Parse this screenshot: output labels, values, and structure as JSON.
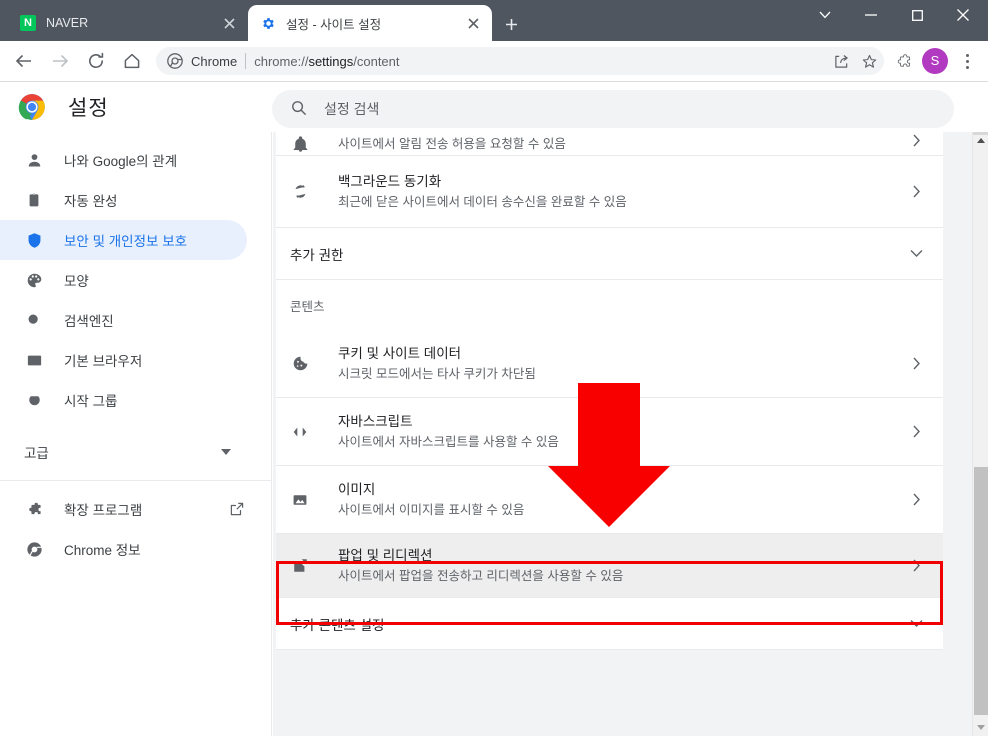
{
  "window": {
    "controls": {
      "chevron_label": "tab-search-chevron",
      "minimize_label": "minimize",
      "maximize_label": "maximize",
      "close_label": "close"
    }
  },
  "tabs": [
    {
      "title": "NAVER",
      "favicon": "N",
      "active": false
    },
    {
      "title": "설정 - 사이트 설정",
      "favicon": "gear",
      "active": true
    }
  ],
  "newtab": {
    "label": "+"
  },
  "omnibox": {
    "scheme_label": "Chrome",
    "url_prefix": "chrome://",
    "url_bold": "settings",
    "url_suffix": "/content",
    "full_url": "chrome://settings/content"
  },
  "settings": {
    "title": "설정",
    "search": {
      "placeholder": "설정 검색",
      "value": ""
    }
  },
  "sidebar": {
    "items": [
      {
        "label": "나와 Google의 관계",
        "icon": "person-icon",
        "active": false
      },
      {
        "label": "자동 완성",
        "icon": "clipboard-icon",
        "active": false
      },
      {
        "label": "보안 및 개인정보 보호",
        "icon": "shield-icon",
        "active": true
      },
      {
        "label": "모양",
        "icon": "palette-icon",
        "active": false
      },
      {
        "label": "검색엔진",
        "icon": "search-icon",
        "active": false
      },
      {
        "label": "기본 브라우저",
        "icon": "browser-icon",
        "active": false
      },
      {
        "label": "시작 그룹",
        "icon": "power-icon",
        "active": false
      }
    ],
    "advanced": {
      "label": "고급"
    },
    "bottom_items": [
      {
        "label": "확장 프로그램",
        "icon": "puzzle-icon",
        "external": true
      },
      {
        "label": "Chrome 정보",
        "icon": "chrome-icon",
        "external": false
      }
    ]
  },
  "content": {
    "rows_top": [
      {
        "title": "",
        "sub": "사이트에서 알림 전송 허용을 요청할 수 있음",
        "icon": "bell-icon",
        "arrow": "chevron-right-icon"
      },
      {
        "title": "백그라운드 동기화",
        "sub": "최근에 닫은 사이트에서 데이터 송수신을 완료할 수 있음",
        "icon": "sync-icon",
        "arrow": "chevron-right-icon"
      }
    ],
    "section_additional_permissions": {
      "label": "추가 권한",
      "chevron": "chevron-down-icon"
    },
    "group_label": "콘텐츠",
    "rows_content": [
      {
        "title": "쿠키 및 사이트 데이터",
        "sub": "시크릿 모드에서는 타사 쿠키가 차단됨",
        "icon": "cookie-icon",
        "arrow": "chevron-right-icon",
        "highlighted": false
      },
      {
        "title": "자바스크립트",
        "sub": "사이트에서 자바스크립트를 사용할 수 있음",
        "icon": "code-icon",
        "arrow": "chevron-right-icon",
        "highlighted": false
      },
      {
        "title": "이미지",
        "sub": "사이트에서 이미지를 표시할 수 있음",
        "icon": "image-icon",
        "arrow": "chevron-right-icon",
        "highlighted": false
      },
      {
        "title": "팝업 및 리디렉션",
        "sub": "사이트에서 팝업을 전송하고 리디렉션을 사용할 수 있음",
        "icon": "popup-redirect-icon",
        "arrow": "chevron-right-icon",
        "highlighted": true
      }
    ],
    "section_additional_content": {
      "label": "추가 콘텐츠 설정",
      "chevron": "chevron-down-icon"
    }
  },
  "annotations": {
    "arrow": {
      "color": "#f80000",
      "direction": "down",
      "points_at": "팝업 및 리디렉션"
    },
    "highlight_box": {
      "color": "#f00000",
      "target": "팝업 및 리디렉션"
    }
  },
  "profile": {
    "initial": "S",
    "color": "#b23ac0"
  },
  "colors": {
    "accent": "#1a73e8",
    "tabstrip": "#4f5660",
    "sidebar_active_bg": "#e8f0fe",
    "annotation_red": "#f80000"
  }
}
